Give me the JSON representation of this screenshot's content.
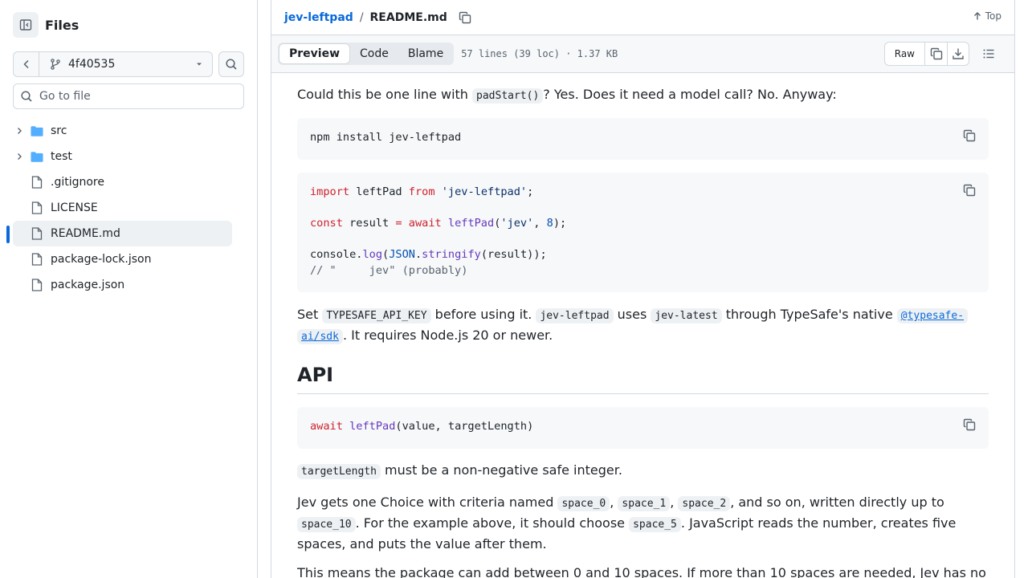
{
  "sidebar": {
    "title": "Files",
    "branch": "4f40535",
    "goto_placeholder": "Go to file",
    "items": [
      {
        "label": "src",
        "type": "folder"
      },
      {
        "label": "test",
        "type": "folder"
      },
      {
        "label": ".gitignore",
        "type": "file"
      },
      {
        "label": "LICENSE",
        "type": "file"
      },
      {
        "label": "README.md",
        "type": "file",
        "active": true
      },
      {
        "label": "package-lock.json",
        "type": "file"
      },
      {
        "label": "package.json",
        "type": "file"
      }
    ]
  },
  "header": {
    "repo": "jev-leftpad",
    "sep": "/",
    "file": "README.md",
    "top_label": "Top"
  },
  "filebar": {
    "tabs": [
      "Preview",
      "Code",
      "Blame"
    ],
    "active_tab": "Preview",
    "meta": "57 lines (39 loc) · 1.37 KB",
    "raw_label": "Raw"
  },
  "readme": {
    "p1": {
      "a": "Could this be one line with ",
      "code": "padStart()",
      "b": "? Yes. Does it need a model call? No. Anyway:"
    },
    "install_cmd": "npm install jev-leftpad",
    "example": {
      "l1": {
        "kw1": "import",
        "id": " leftPad ",
        "kw2": "from",
        "s": " 'jev-leftpad'",
        "end": ";"
      },
      "l2": {
        "kw1": "const",
        "id": " result ",
        "op": "=",
        "kw2": " await",
        "fn": " leftPad",
        "a": "(",
        "s": "'jev'",
        "b": ", ",
        "n": "8",
        "c": ");"
      },
      "l3": {
        "a": "console.",
        "fn1": "log",
        "b": "(",
        "fn2": "JSON",
        "c": ".",
        "fn3": "stringify",
        "d": "(result));"
      },
      "l4": "// \"     jev\" (probably)"
    },
    "p2": {
      "a": "Set ",
      "code1": "TYPESAFE_API_KEY",
      "b": " before using it. ",
      "code2": "jev-leftpad",
      "c": " uses ",
      "code3": "jev-latest",
      "d": " through TypeSafe's native ",
      "link_l1": "@typesafe-",
      "link_l2": "ai/sdk",
      "e": ". It requires Node.js 20 or newer."
    },
    "api_heading": "API",
    "api_code": {
      "kw": "await",
      "fn": " leftPad",
      "rest": "(value, targetLength)"
    },
    "p3": {
      "code": "targetLength",
      "a": " must be a non-negative safe integer."
    },
    "p4": {
      "a": "Jev gets one Choice with criteria named ",
      "c0": "space_0",
      "s1": ", ",
      "c1": "space_1",
      "s2": ", ",
      "c2": "space_2",
      "b": ", and so on, written directly up to",
      "c10": "space_10",
      "c": ". For the example above, it should choose ",
      "c5": "space_5",
      "d": ". JavaScript reads the number, creates five",
      "e": "spaces, and puts the value after them."
    },
    "p5": "This means the package can add between 0 and 10 spaces. If more than 10 spaces are needed, Jev has no"
  }
}
